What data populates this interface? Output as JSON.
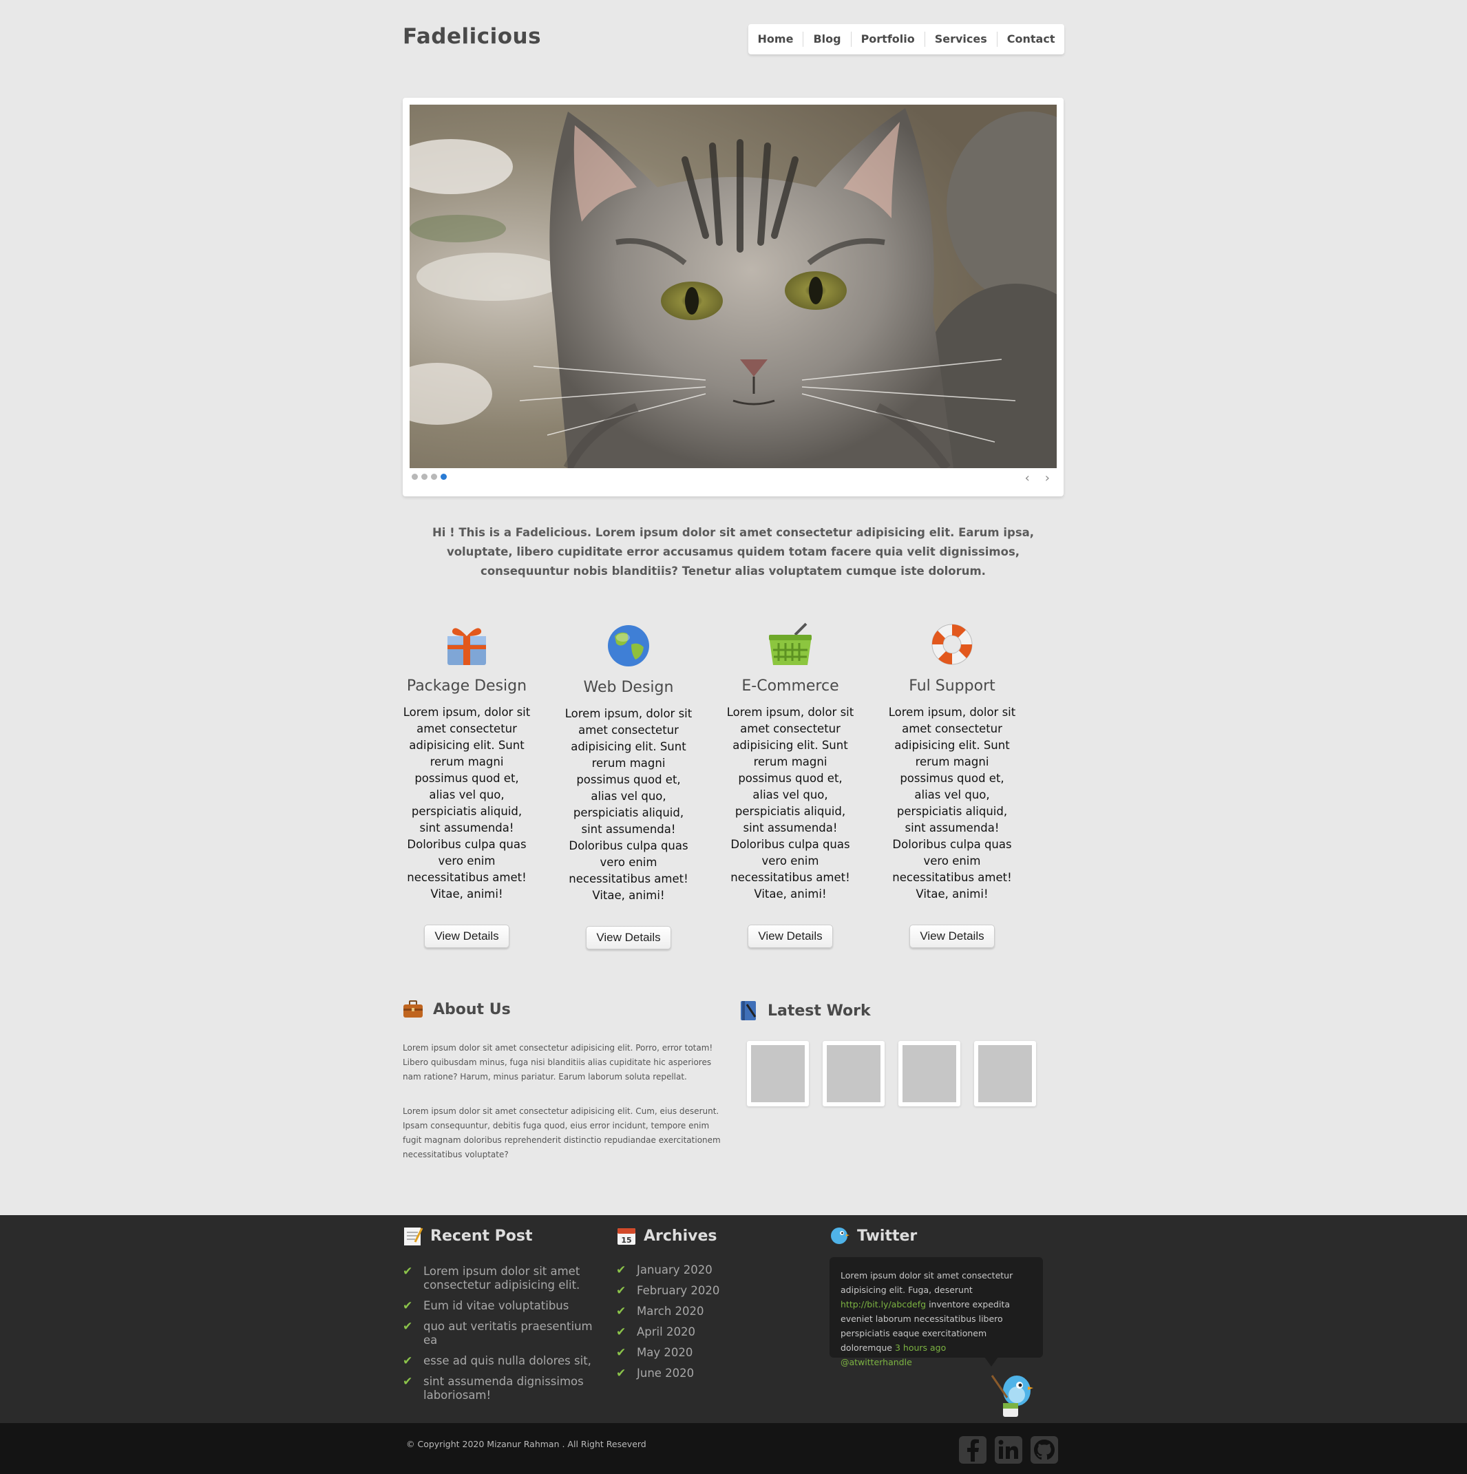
{
  "header": {
    "logo": "Fadelicious",
    "nav": [
      "Home",
      "Blog",
      "Portfolio",
      "Services",
      "Contact"
    ]
  },
  "slider": {
    "dot_count": 4,
    "active_dot": 4,
    "prev": "‹",
    "next": "›"
  },
  "intro": "Hi ! This is a Fadelicious. Lorem ipsum dolor sit amet consectetur adipisicing elit. Earum ipsa, voluptate, libero cupiditate error accusamus quidem totam facere quia velit dignissimos, consequuntur nobis blanditiis? Tenetur alias voluptatem cumque iste dolorum.",
  "services": [
    {
      "title": "Package Design",
      "icon": "gift-icon",
      "text": "Lorem ipsum, dolor sit amet consectetur adipisicing elit. Sunt rerum magni possimus quod et, alias vel quo, perspiciatis aliquid, sint assumenda! Doloribus culpa quas vero enim necessitatibus amet! Vitae, animi!",
      "button": "View Details"
    },
    {
      "title": "Web Design",
      "icon": "globe-icon",
      "text": "Lorem ipsum, dolor sit amet consectetur adipisicing elit. Sunt rerum magni possimus quod et, alias vel quo, perspiciatis aliquid, sint assumenda! Doloribus culpa quas vero enim necessitatibus amet! Vitae, animi!",
      "button": "View Details"
    },
    {
      "title": "E-Commerce",
      "icon": "basket-icon",
      "text": "Lorem ipsum, dolor sit amet consectetur adipisicing elit. Sunt rerum magni possimus quod et, alias vel quo, perspiciatis aliquid, sint assumenda! Doloribus culpa quas vero enim necessitatibus amet! Vitae, animi!",
      "button": "View Details"
    },
    {
      "title": "Ful Support",
      "icon": "lifebuoy-icon",
      "text": "Lorem ipsum, dolor sit amet consectetur adipisicing elit. Sunt rerum magni possimus quod et, alias vel quo, perspiciatis aliquid, sint assumenda! Doloribus culpa quas vero enim necessitatibus amet! Vitae, animi!",
      "button": "View Details"
    }
  ],
  "about": {
    "title": "About Us",
    "p1": "Lorem ipsum dolor sit amet consectetur adipisicing elit. Porro, error totam! Libero quibusdam minus, fuga nisi blanditiis alias cupiditate hic asperiores nam ratione? Harum, minus pariatur. Earum laborum soluta repellat.",
    "p2": "Lorem ipsum dolor sit amet consectetur adipisicing elit. Cum, eius deserunt. Ipsam consequuntur, debitis fuga quod, eius error incidunt, tempore enim fugit magnam doloribus reprehenderit distinctio repudiandae exercitationem necessitatibus voluptate?"
  },
  "latest_work": {
    "title": "Latest Work",
    "thumb_count": 4
  },
  "footer": {
    "recent_post": {
      "title": "Recent Post",
      "items": [
        "Lorem ipsum dolor sit amet consectetur adipisicing elit.",
        "Eum id vitae voluptatibus",
        "quo aut veritatis praesentium ea",
        "esse ad quis nulla dolores sit,",
        "sint assumenda dignissimos laboriosam!"
      ]
    },
    "archives": {
      "title": "Archives",
      "items": [
        "January 2020",
        "February 2020",
        "March 2020",
        "April 2020",
        "May 2020",
        "June 2020"
      ]
    },
    "twitter": {
      "title": "Twitter",
      "text1": "Lorem ipsum dolor sit amet consectetur adipisicing elit. Fuga, deserunt ",
      "link": "http://bit.ly/abcdefg",
      "text2": " inventore expedita eveniet laborum necessitatibus libero perspiciatis eaque exercitationem doloremque ",
      "time": "3 hours ago",
      "handle": "@atwitterhandle"
    },
    "copyright": "© Copyright 2020  Mizanur Rahman . All Right Reseverd",
    "social": [
      "facebook-icon",
      "linkedin-icon",
      "github-icon"
    ]
  },
  "colors": {
    "accent": "#2a7bd4",
    "link_green": "#7cb342",
    "check_green": "#8bc34a",
    "footer_bg": "#2b2b2b",
    "bottom_bg": "#141414"
  }
}
